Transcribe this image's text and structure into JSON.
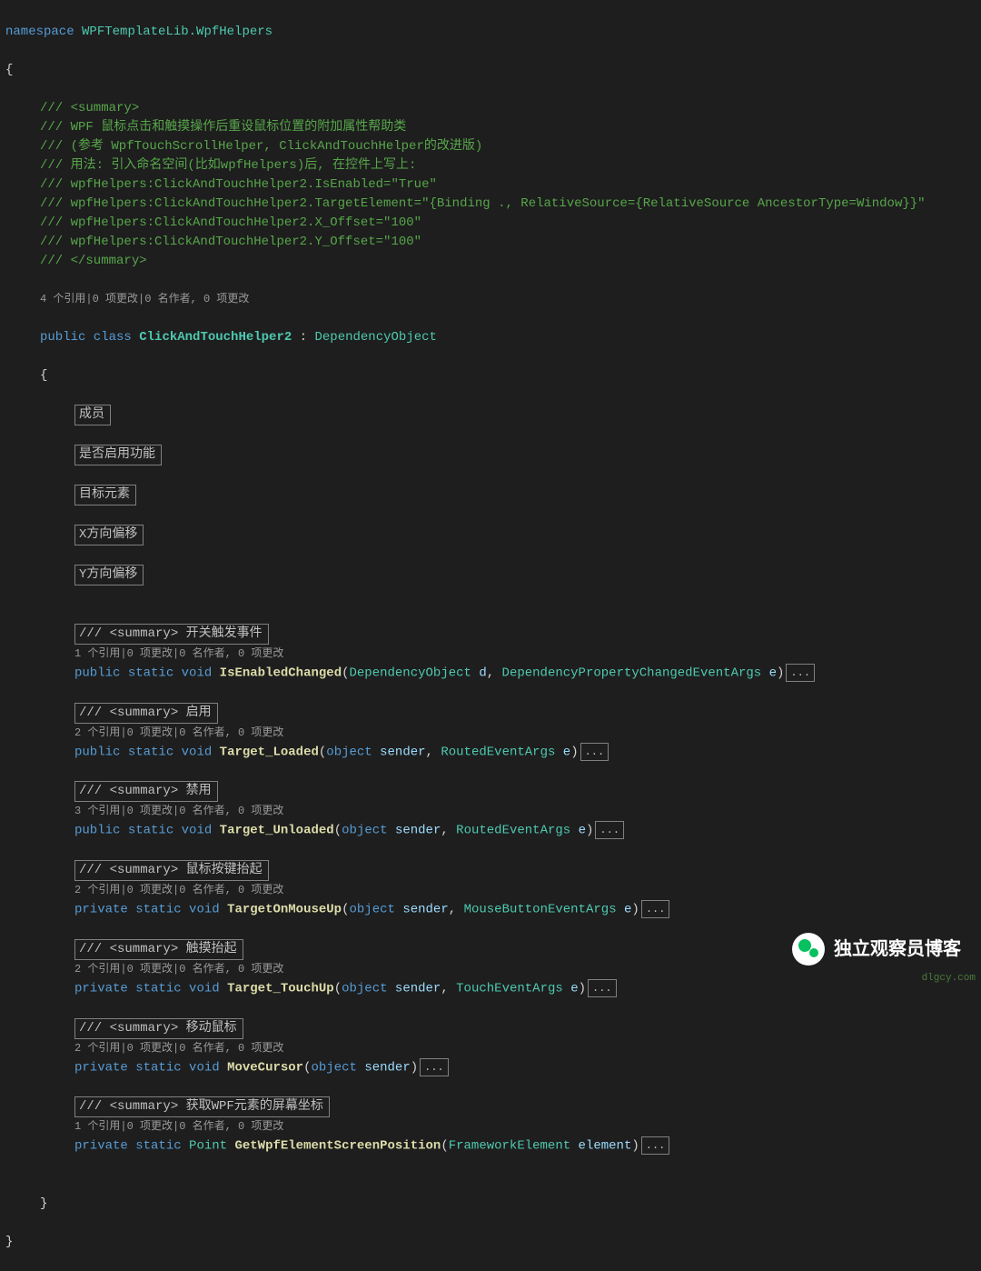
{
  "namespace": "WPFTemplateLib.WpfHelpers",
  "doc_comments": [
    "/// <summary>",
    "/// WPF 鼠标点击和触摸操作后重设鼠标位置的附加属性帮助类",
    "/// (参考 WpfTouchScrollHelper, ClickAndTouchHelper的改进版)",
    "/// 用法: 引入命名空间(比如wpfHelpers)后, 在控件上写上:",
    "/// wpfHelpers:ClickAndTouchHelper2.IsEnabled=\"True\"",
    "/// wpfHelpers:ClickAndTouchHelper2.TargetElement=\"{Binding ., RelativeSource={RelativeSource AncestorType=Window}}\"",
    "/// wpfHelpers:ClickAndTouchHelper2.X_Offset=\"100\"",
    "/// wpfHelpers:ClickAndTouchHelper2.Y_Offset=\"100\"",
    "/// </summary>"
  ],
  "class_codelens": "4 个引用|0 项更改|0 名作者, 0 项更改",
  "class_decl": {
    "modifiers": "public class",
    "name": "ClickAndTouchHelper2",
    "sep": " : ",
    "base": "DependencyObject"
  },
  "regions": [
    "成员",
    "是否启用功能",
    "目标元素",
    "X方向偏移",
    "Y方向偏移"
  ],
  "methods": [
    {
      "summary": "/// <summary> 开关触发事件",
      "codelens": "1 个引用|0 项更改|0 名作者, 0 项更改",
      "access": "public",
      "static": "static",
      "ret": "void",
      "name": "IsEnabledChanged",
      "params": [
        {
          "type": "DependencyObject",
          "name": "d"
        },
        {
          "type": "DependencyPropertyChangedEventArgs",
          "name": "e"
        }
      ],
      "fold": "..."
    },
    {
      "summary": "/// <summary> 启用",
      "codelens": "2 个引用|0 项更改|0 名作者, 0 项更改",
      "access": "public",
      "static": "static",
      "ret": "void",
      "name": "Target_Loaded",
      "params": [
        {
          "type": "object",
          "name": "sender"
        },
        {
          "type": "RoutedEventArgs",
          "name": "e"
        }
      ],
      "fold": "..."
    },
    {
      "summary": "/// <summary> 禁用",
      "codelens": "3 个引用|0 项更改|0 名作者, 0 项更改",
      "access": "public",
      "static": "static",
      "ret": "void",
      "name": "Target_Unloaded",
      "params": [
        {
          "type": "object",
          "name": "sender"
        },
        {
          "type": "RoutedEventArgs",
          "name": "e"
        }
      ],
      "fold": "..."
    },
    {
      "summary": "/// <summary> 鼠标按键抬起",
      "codelens": "2 个引用|0 项更改|0 名作者, 0 项更改",
      "access": "private",
      "static": "static",
      "ret": "void",
      "name": "TargetOnMouseUp",
      "params": [
        {
          "type": "object",
          "name": "sender"
        },
        {
          "type": "MouseButtonEventArgs",
          "name": "e"
        }
      ],
      "fold": "..."
    },
    {
      "summary": "/// <summary> 触摸抬起",
      "codelens": "2 个引用|0 项更改|0 名作者, 0 项更改",
      "access": "private",
      "static": "static",
      "ret": "void",
      "name": "Target_TouchUp",
      "params": [
        {
          "type": "object",
          "name": "sender"
        },
        {
          "type": "TouchEventArgs",
          "name": "e"
        }
      ],
      "fold": "..."
    },
    {
      "summary": "/// <summary> 移动鼠标",
      "codelens": "2 个引用|0 项更改|0 名作者, 0 项更改",
      "access": "private",
      "static": "static",
      "ret": "void",
      "name": "MoveCursor",
      "params": [
        {
          "type": "object",
          "name": "sender"
        }
      ],
      "fold": "..."
    },
    {
      "summary": "/// <summary> 获取WPF元素的屏幕坐标",
      "codelens": "1 个引用|0 项更改|0 名作者, 0 项更改",
      "access": "private",
      "static": "static",
      "ret": "Point",
      "name": "GetWpfElementScreenPosition",
      "params": [
        {
          "type": "FrameworkElement",
          "name": "element"
        }
      ],
      "fold": "..."
    }
  ],
  "braces": {
    "open": "{",
    "close": "}"
  },
  "watermark": {
    "text": "独立观察员博客",
    "url": "dlgcy.com"
  },
  "ellipsis": "..."
}
